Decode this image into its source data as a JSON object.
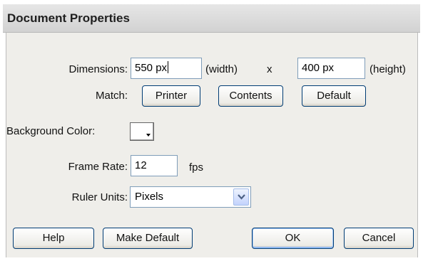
{
  "dialog": {
    "title": "Document Properties"
  },
  "dimensions": {
    "label": "Dimensions:",
    "width_value": "550 px",
    "width_label": "(width)",
    "separator": "x",
    "height_value": "400 px",
    "height_label": "(height)"
  },
  "match": {
    "label": "Match:",
    "printer_label": "Printer",
    "contents_label": "Contents",
    "default_label": "Default"
  },
  "background": {
    "label": "Background Color:",
    "color": "#ffffff"
  },
  "frame_rate": {
    "label": "Frame Rate:",
    "value": "12",
    "unit": "fps"
  },
  "ruler_units": {
    "label": "Ruler Units:",
    "selected": "Pixels",
    "icon": "chevron-down-icon"
  },
  "footer": {
    "help_label": "Help",
    "make_default_label": "Make Default",
    "ok_label": "OK",
    "cancel_label": "Cancel"
  },
  "colors": {
    "button_border": "#003c74",
    "field_border": "#7f9db9",
    "panel_background": "#efeeea"
  }
}
